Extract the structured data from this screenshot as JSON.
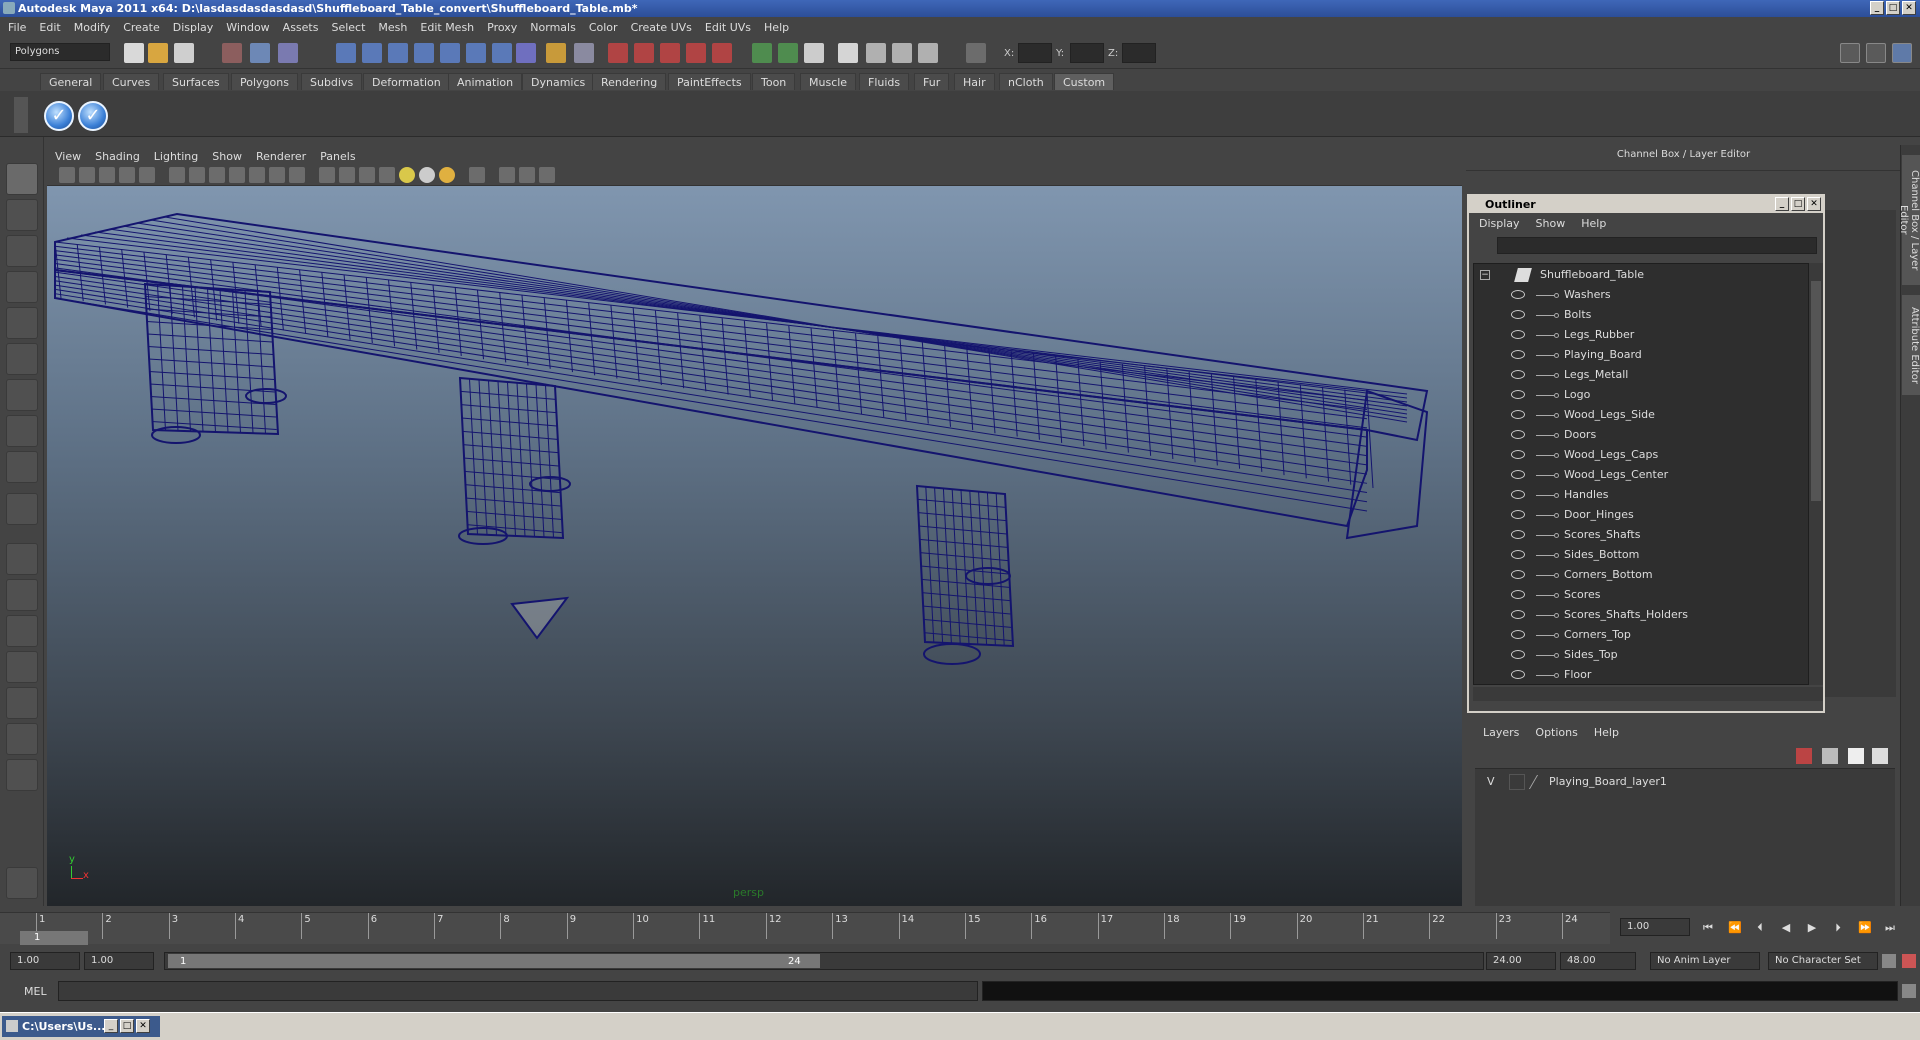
{
  "window": {
    "title": "Autodesk Maya 2011 x64: D:\\lasdasdasdasdasd\\Shuffleboard_Table_convert\\Shuffleboard_Table.mb*"
  },
  "menubar": [
    "File",
    "Edit",
    "Modify",
    "Create",
    "Display",
    "Window",
    "Assets",
    "Select",
    "Mesh",
    "Edit Mesh",
    "Proxy",
    "Normals",
    "Color",
    "Create UVs",
    "Edit UVs",
    "Help"
  ],
  "statusline": {
    "mode": "Polygons",
    "x_label": "X:",
    "y_label": "Y:",
    "z_label": "Z:"
  },
  "shelf": {
    "tabs": [
      "General",
      "Curves",
      "Surfaces",
      "Polygons",
      "Subdivs",
      "Deformation",
      "Animation",
      "Dynamics",
      "Rendering",
      "PaintEffects",
      "Toon",
      "Muscle",
      "Fluids",
      "Fur",
      "Hair",
      "nCloth",
      "Custom"
    ],
    "active_tab": "Custom"
  },
  "viewport": {
    "menus": [
      "View",
      "Shading",
      "Lighting",
      "Show",
      "Renderer",
      "Panels"
    ],
    "camera_label": "persp",
    "axis_x": "x",
    "axis_y": "y",
    "wire_color": "#14146e"
  },
  "channelbox": {
    "title": "Channel Box / Layer Editor",
    "side_tabs": [
      "Channel Box / Layer Editor",
      "Attribute Editor"
    ]
  },
  "outliner": {
    "title": "Outliner",
    "menus": [
      "Display",
      "Show",
      "Help"
    ],
    "root": "Shuffleboard_Table",
    "items": [
      "Washers",
      "Bolts",
      "Legs_Rubber",
      "Playing_Board",
      "Legs_Metall",
      "Logo",
      "Wood_Legs_Side",
      "Doors",
      "Wood_Legs_Caps",
      "Wood_Legs_Center",
      "Handles",
      "Door_Hinges",
      "Scores_Shafts",
      "Sides_Bottom",
      "Corners_Bottom",
      "Scores",
      "Scores_Shafts_Holders",
      "Corners_Top",
      "Sides_Top",
      "Floor"
    ]
  },
  "layers": {
    "menus": [
      "Layers",
      "Options",
      "Help"
    ],
    "rows": [
      {
        "visible": "V",
        "name": "Playing_Board_layer1"
      }
    ]
  },
  "timeline": {
    "ticks": [
      "1",
      "2",
      "3",
      "4",
      "5",
      "6",
      "7",
      "8",
      "9",
      "10",
      "11",
      "12",
      "13",
      "14",
      "15",
      "16",
      "17",
      "18",
      "19",
      "20",
      "21",
      "22",
      "23",
      "24"
    ],
    "current_frame": "1",
    "current_time_field": "1.00"
  },
  "range": {
    "start_time": "1.00",
    "playback_start": "1.00",
    "range_start": "1",
    "range_end": "24",
    "playback_end": "24.00",
    "end_time": "48.00",
    "anim_layer": "No Anim Layer",
    "character_set": "No Character Set"
  },
  "command": {
    "label": "MEL"
  },
  "taskbar": {
    "item": "C:\\Users\\Us..."
  }
}
